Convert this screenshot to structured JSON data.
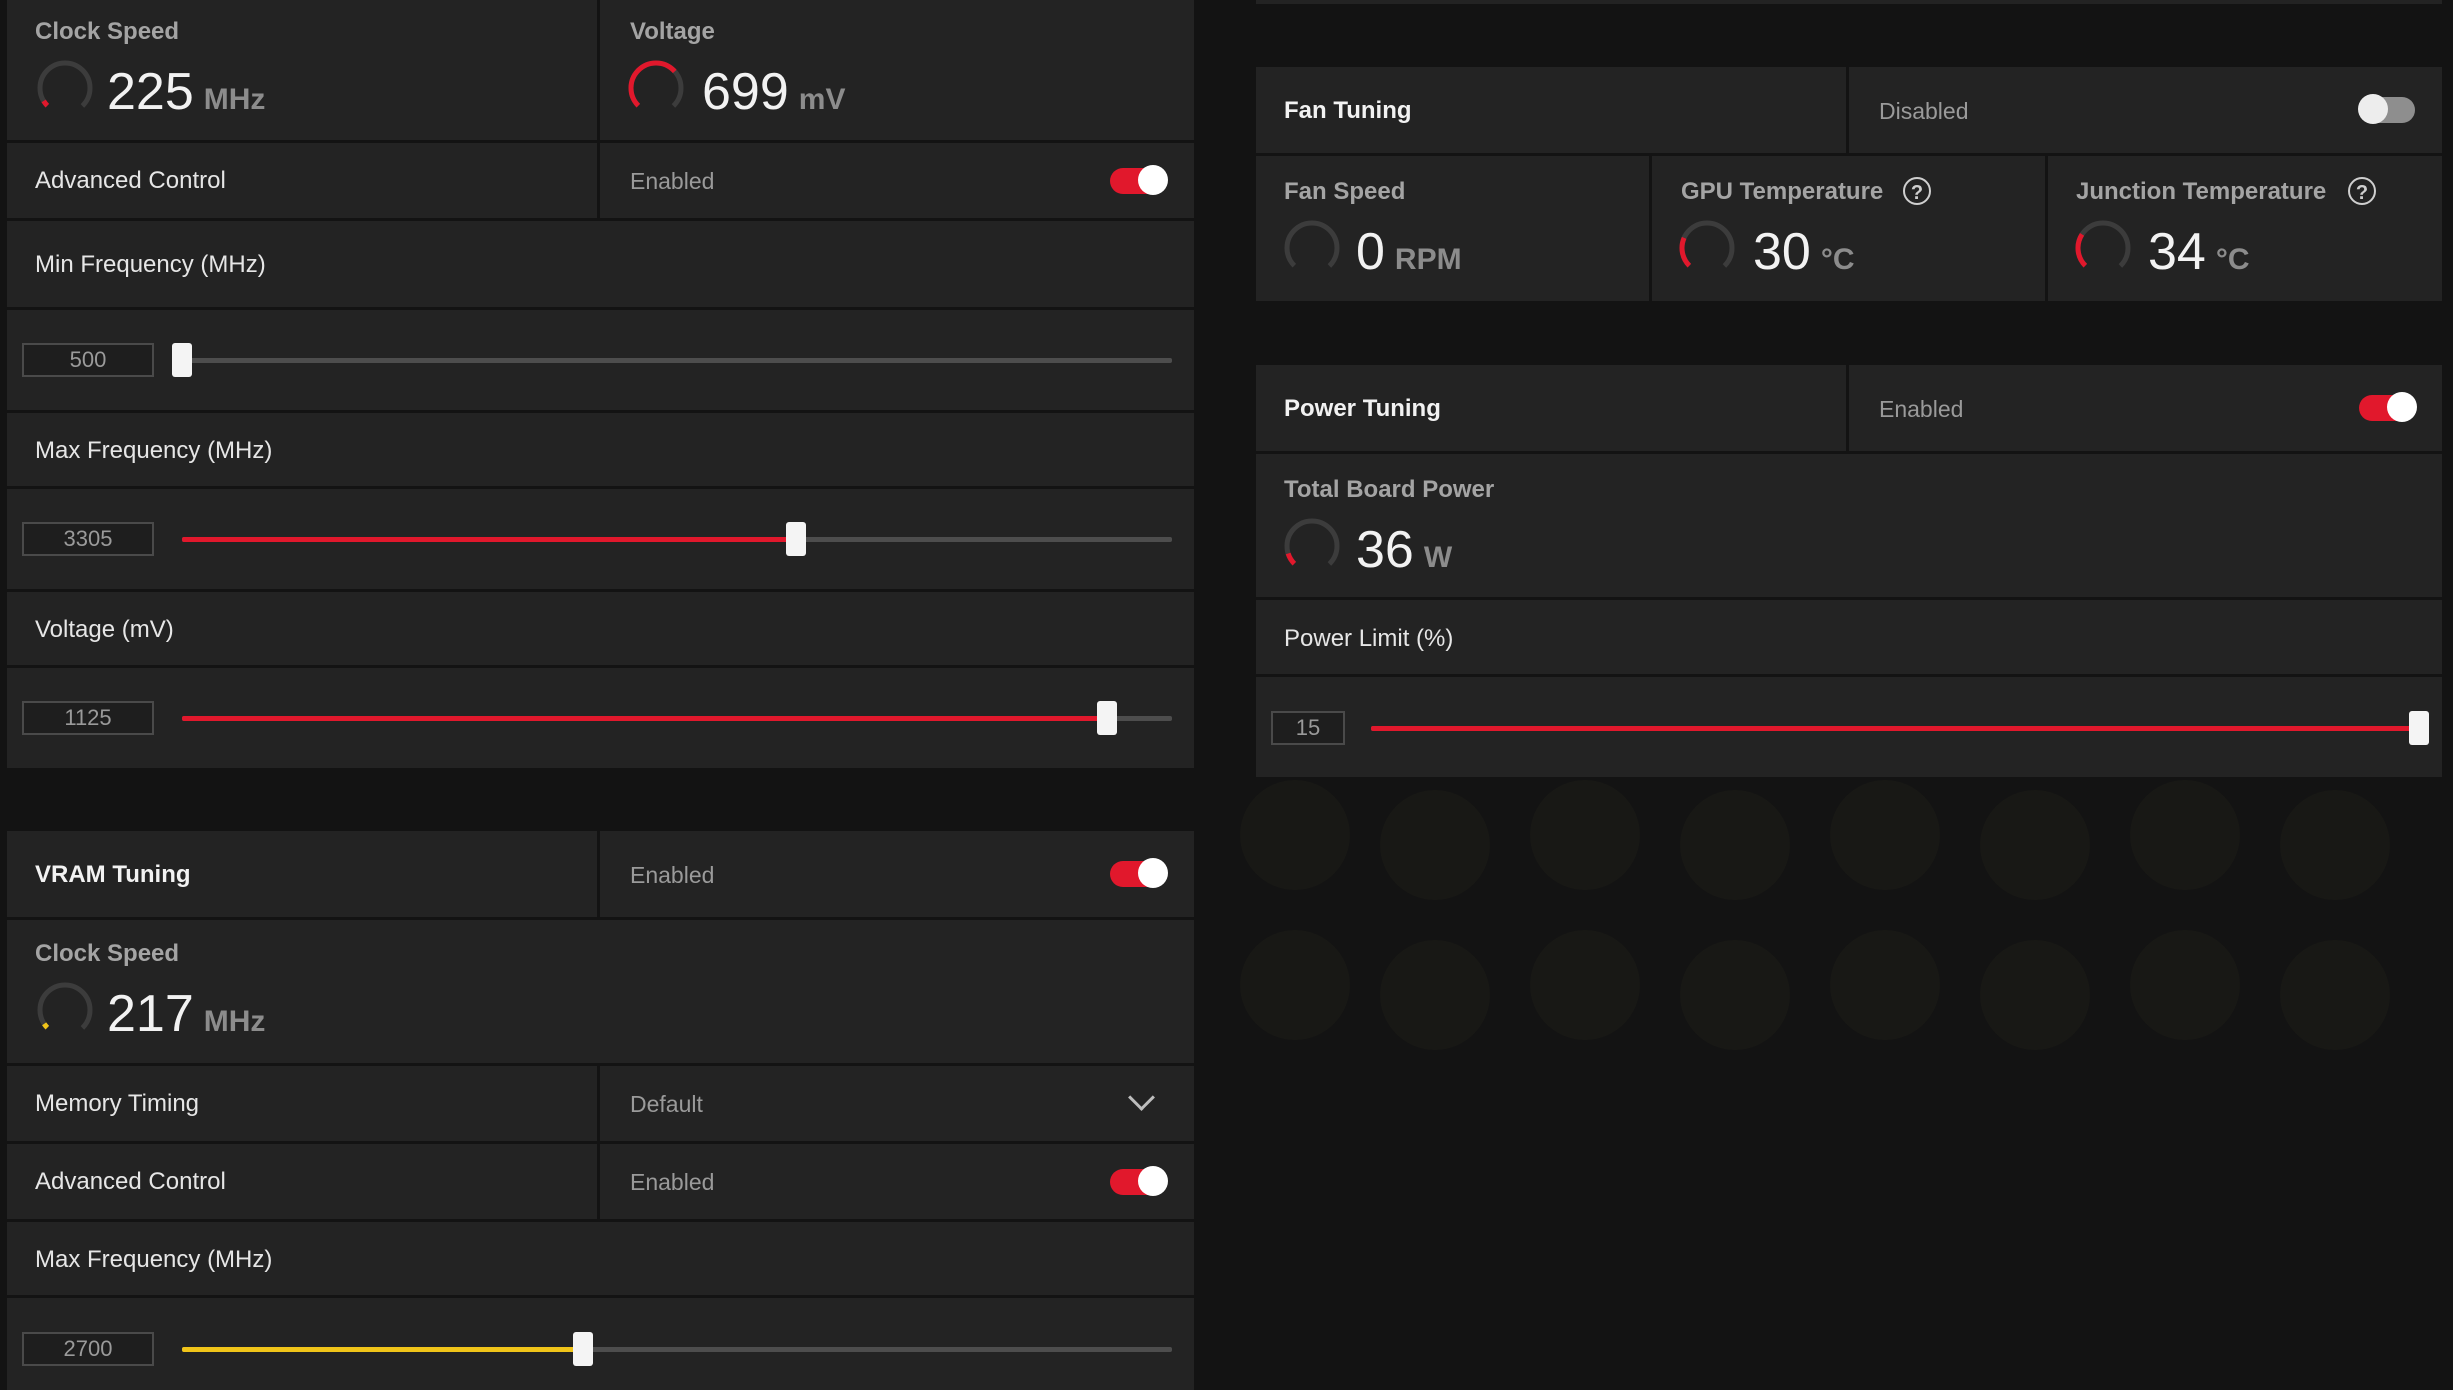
{
  "colors": {
    "accent_red": "#e1182c",
    "accent_yellow": "#f0c419",
    "panel": "#232323",
    "background": "#131313"
  },
  "gpu": {
    "clock_speed": {
      "label": "Clock Speed",
      "value": "225",
      "unit": "MHz"
    },
    "voltage": {
      "label": "Voltage",
      "value": "699",
      "unit": "mV"
    },
    "advanced_control": {
      "label": "Advanced Control",
      "state": "Enabled",
      "on": true
    },
    "min_frequency": {
      "label": "Min Frequency (MHz)",
      "value": "500",
      "fraction": 0.0
    },
    "max_frequency": {
      "label": "Max Frequency (MHz)",
      "value": "3305",
      "fraction": 0.62
    },
    "voltage_slider": {
      "label": "Voltage (mV)",
      "value": "1125",
      "fraction": 0.934
    }
  },
  "vram": {
    "title": "VRAM Tuning",
    "state": "Enabled",
    "clock_speed": {
      "label": "Clock Speed",
      "value": "217",
      "unit": "MHz"
    },
    "memory_timing": {
      "label": "Memory Timing",
      "value": "Default"
    },
    "advanced_control": {
      "label": "Advanced Control",
      "state": "Enabled",
      "on": true
    },
    "max_frequency": {
      "label": "Max Frequency (MHz)",
      "value": "2700",
      "fraction": 0.405
    }
  },
  "fan": {
    "title": "Fan Tuning",
    "state": "Disabled",
    "fan_speed": {
      "label": "Fan Speed",
      "value": "0",
      "unit": "RPM"
    },
    "gpu_temp": {
      "label": "GPU Temperature",
      "value": "30",
      "unit": "°C"
    },
    "junction_temp": {
      "label": "Junction Temperature",
      "value": "34",
      "unit": "°C"
    },
    "help_glyph": "?"
  },
  "power": {
    "title": "Power Tuning",
    "state": "Enabled",
    "total_board_power": {
      "label": "Total Board Power",
      "value": "36",
      "unit": "W"
    },
    "power_limit": {
      "label": "Power Limit (%)",
      "value": "15",
      "fraction": 1.0
    }
  },
  "icons": [
    "gauge-icon",
    "toggle-switch",
    "help-icon",
    "chevron-down-icon"
  ]
}
